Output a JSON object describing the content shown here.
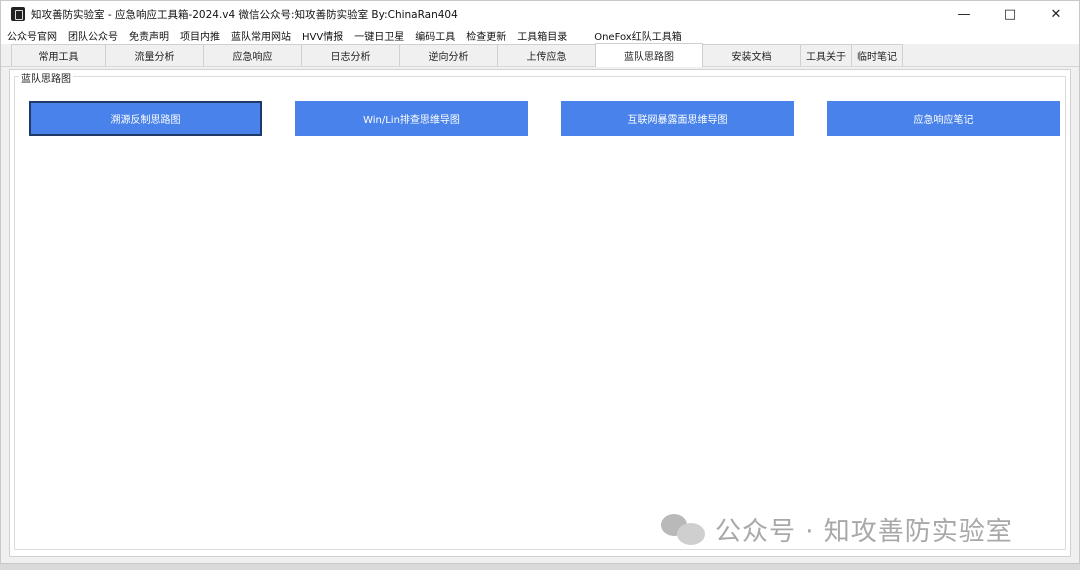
{
  "window": {
    "title": "知攻善防实验室 - 应急响应工具箱-2024.v4    微信公众号:知攻善防实验室    By:ChinaRan404"
  },
  "menu": [
    "公众号官网",
    "团队公众号",
    "免责声明",
    "项目内推",
    "蓝队常用网站",
    "HVV情报",
    "一键日卫星",
    "编码工具",
    "检查更新",
    "工具箱目录",
    "OneFox红队工具箱"
  ],
  "tabs": [
    "常用工具",
    "流量分析",
    "应急响应",
    "日志分析",
    "逆向分析",
    "上传应急",
    "蓝队思路图",
    "安装文档",
    "工具关于",
    "临时笔记"
  ],
  "active_tab": "蓝队思路图",
  "group": {
    "label": "蓝队思路图",
    "buttons": [
      "溯源反制思路图",
      "Win/Lin排查思维导图",
      "互联网暴露面思维导图",
      "应急响应笔记"
    ]
  },
  "watermark": "公众号 · 知攻善防实验室",
  "colors": {
    "button_bg": "#4882ea",
    "button_text": "#ffffff"
  }
}
